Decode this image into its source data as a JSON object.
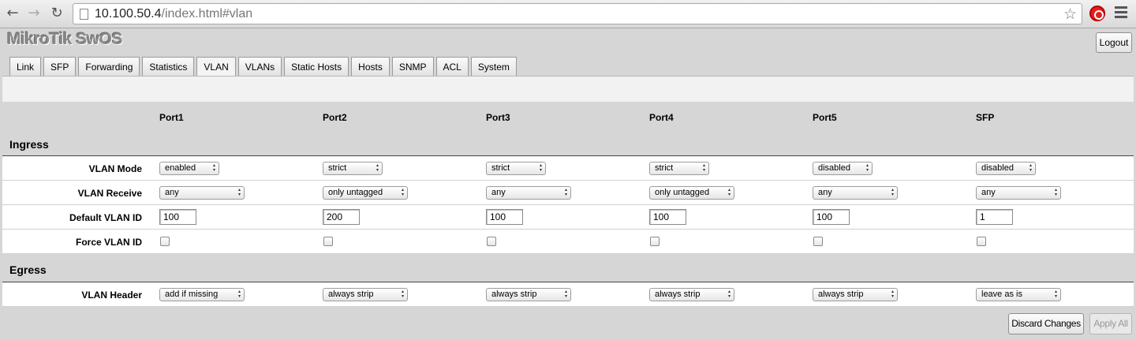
{
  "browser": {
    "url_host": "10.100.50.4",
    "url_path": "/index.html#vlan"
  },
  "app": {
    "title": "MikroTik SwOS",
    "logout_label": "Logout"
  },
  "tabs": [
    {
      "label": "Link"
    },
    {
      "label": "SFP"
    },
    {
      "label": "Forwarding"
    },
    {
      "label": "Statistics"
    },
    {
      "label": "VLAN",
      "active": true
    },
    {
      "label": "VLANs"
    },
    {
      "label": "Static Hosts"
    },
    {
      "label": "Hosts"
    },
    {
      "label": "SNMP"
    },
    {
      "label": "ACL"
    },
    {
      "label": "System"
    }
  ],
  "ports": [
    "Port1",
    "Port2",
    "Port3",
    "Port4",
    "Port5",
    "SFP"
  ],
  "ingress": {
    "title": "Ingress",
    "vlan_mode": {
      "label": "VLAN Mode",
      "values": [
        "enabled",
        "strict",
        "strict",
        "strict",
        "disabled",
        "disabled"
      ]
    },
    "vlan_receive": {
      "label": "VLAN Receive",
      "values": [
        "any",
        "only untagged",
        "any",
        "only untagged",
        "any",
        "any"
      ]
    },
    "default_vlan_id": {
      "label": "Default VLAN ID",
      "values": [
        "100",
        "200",
        "100",
        "100",
        "100",
        "1"
      ]
    },
    "force_vlan_id": {
      "label": "Force VLAN ID",
      "values": [
        false,
        false,
        false,
        false,
        false,
        false
      ]
    }
  },
  "egress": {
    "title": "Egress",
    "vlan_header": {
      "label": "VLAN Header",
      "values": [
        "add if missing",
        "always strip",
        "always strip",
        "always strip",
        "always strip",
        "leave as is"
      ]
    }
  },
  "actions": {
    "discard_label": "Discard Changes",
    "apply_label": "Apply All",
    "apply_enabled": false
  }
}
